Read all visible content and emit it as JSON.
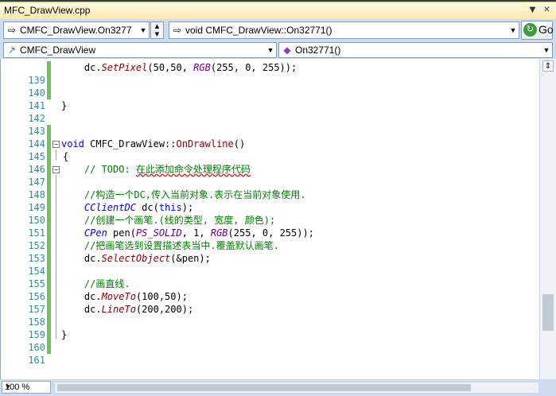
{
  "tab": {
    "title": "MFC_DrawView.cpp"
  },
  "nav": {
    "scope_value": "CMFC_DrawView.On3277",
    "method_value": "void CMFC_DrawView::On32771()",
    "go_label": "Go",
    "class_value": "CMFC_DrawView",
    "member_value": "On32771()"
  },
  "editor": {
    "lines": [
      {
        "n": "139",
        "code": "    dc.SetPixel(50,50, RGB(255, 0, 255));"
      },
      {
        "n": "140",
        "code": ""
      },
      {
        "n": "141",
        "code": ""
      },
      {
        "n": "142",
        "code": "}"
      },
      {
        "n": "143",
        "code": ""
      },
      {
        "n": "144",
        "code": ""
      },
      {
        "n": "145",
        "code": "void CMFC_DrawView::OnDrawline()"
      },
      {
        "n": "146",
        "code": "{"
      },
      {
        "n": "147",
        "code": "    // TODO: 在此添加命令处理程序代码"
      },
      {
        "n": "148",
        "code": ""
      },
      {
        "n": "149",
        "code": "    //构造一个DC,传入当前对象.表示在当前对象使用."
      },
      {
        "n": "150",
        "code": "    CClientDC dc(this);"
      },
      {
        "n": "151",
        "code": "    //创建一个画笔.(线的类型, 宽度, 颜色);"
      },
      {
        "n": "152",
        "code": "    CPen pen(PS_SOLID, 1, RGB(255, 0, 255));"
      },
      {
        "n": "153",
        "code": "    //把画笔选到设置描述表当中.覆盖默认画笔."
      },
      {
        "n": "154",
        "code": "    dc.SelectObject(&pen);"
      },
      {
        "n": "155",
        "code": ""
      },
      {
        "n": "156",
        "code": "    //画直线."
      },
      {
        "n": "157",
        "code": "    dc.MoveTo(100,50);"
      },
      {
        "n": "158",
        "code": "    dc.LineTo(200,200);"
      },
      {
        "n": "159",
        "code": ""
      },
      {
        "n": "160",
        "code": "}"
      },
      {
        "n": "161",
        "code": ""
      }
    ]
  },
  "status": {
    "zoom": "100 %"
  },
  "colors": {
    "accent_tab": "#ffe8a6",
    "change_bar": "#6cc55c",
    "line_number": "#2b91af"
  }
}
